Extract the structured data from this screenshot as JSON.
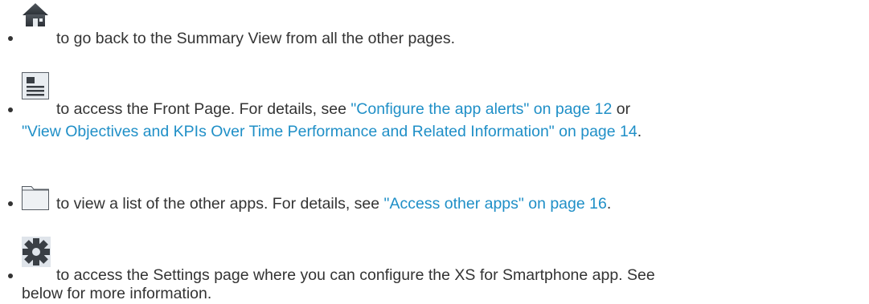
{
  "items": [
    {
      "icon": "home-icon",
      "text": "to go back to the Summary View from all the other pages."
    },
    {
      "icon": "front-page-icon",
      "text_before": "to access the Front Page. For details, see ",
      "link1": "\"Configure the app alerts\" on page 12",
      "text_mid": " or",
      "link2": "\"View Objectives and KPIs Over Time Performance and Related Information\" on page 14",
      "text_end": "."
    },
    {
      "icon": "folder-icon",
      "text_before": "to view a list of the other apps. For details, see ",
      "link": "\"Access other apps\" on page 16",
      "text_end": "."
    },
    {
      "icon": "gear-icon",
      "line1": "to access the Settings page where you can configure the XS for Smartphone app. See",
      "line2": "below for more information."
    }
  ],
  "colors": {
    "text": "#333333",
    "link": "#1f8fc7",
    "icon_dark": "#3a3f45",
    "icon_light": "#dfe4ea"
  }
}
